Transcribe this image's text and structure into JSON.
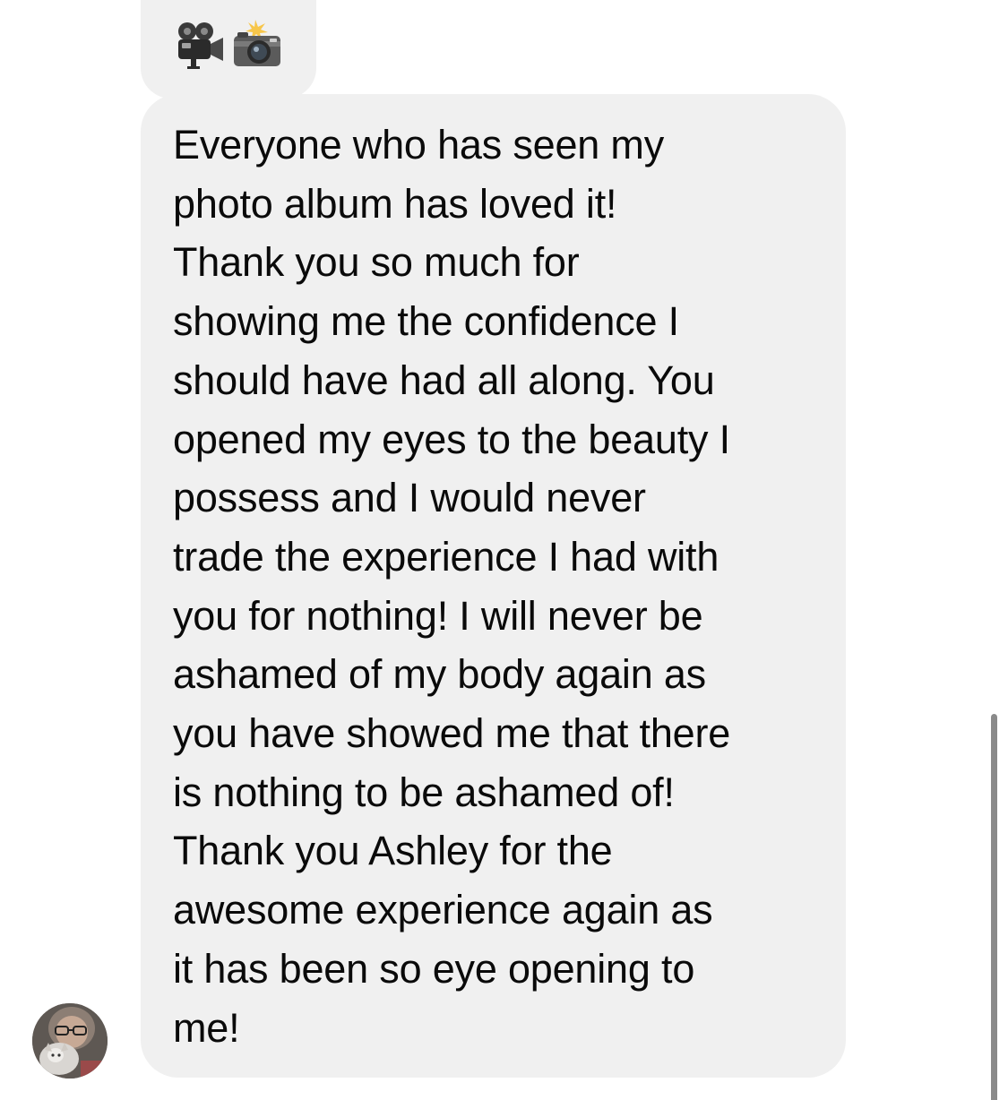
{
  "conversation": {
    "attachment_emojis": [
      "movie-camera-icon",
      "camera-with-flash-icon"
    ],
    "message": {
      "lines": [
        "Everyone who has seen my",
        "photo album has loved it!",
        "Thank you so much for",
        "showing me the confidence I",
        "should have had all along. You",
        "opened my eyes to the beauty I",
        "possess and I would never",
        "trade the experience I had with",
        "you for nothing! I will never be",
        "ashamed of my body again as",
        "you have showed me that there",
        "is nothing to be ashamed of!",
        "Thank you Ashley for the",
        "awesome experience again as",
        "it has been so eye opening to",
        "me!"
      ]
    },
    "colors": {
      "bubble_background": "#f0f0f0",
      "text": "#0a0a0a",
      "scrollbar": "#8a8a8a"
    }
  }
}
